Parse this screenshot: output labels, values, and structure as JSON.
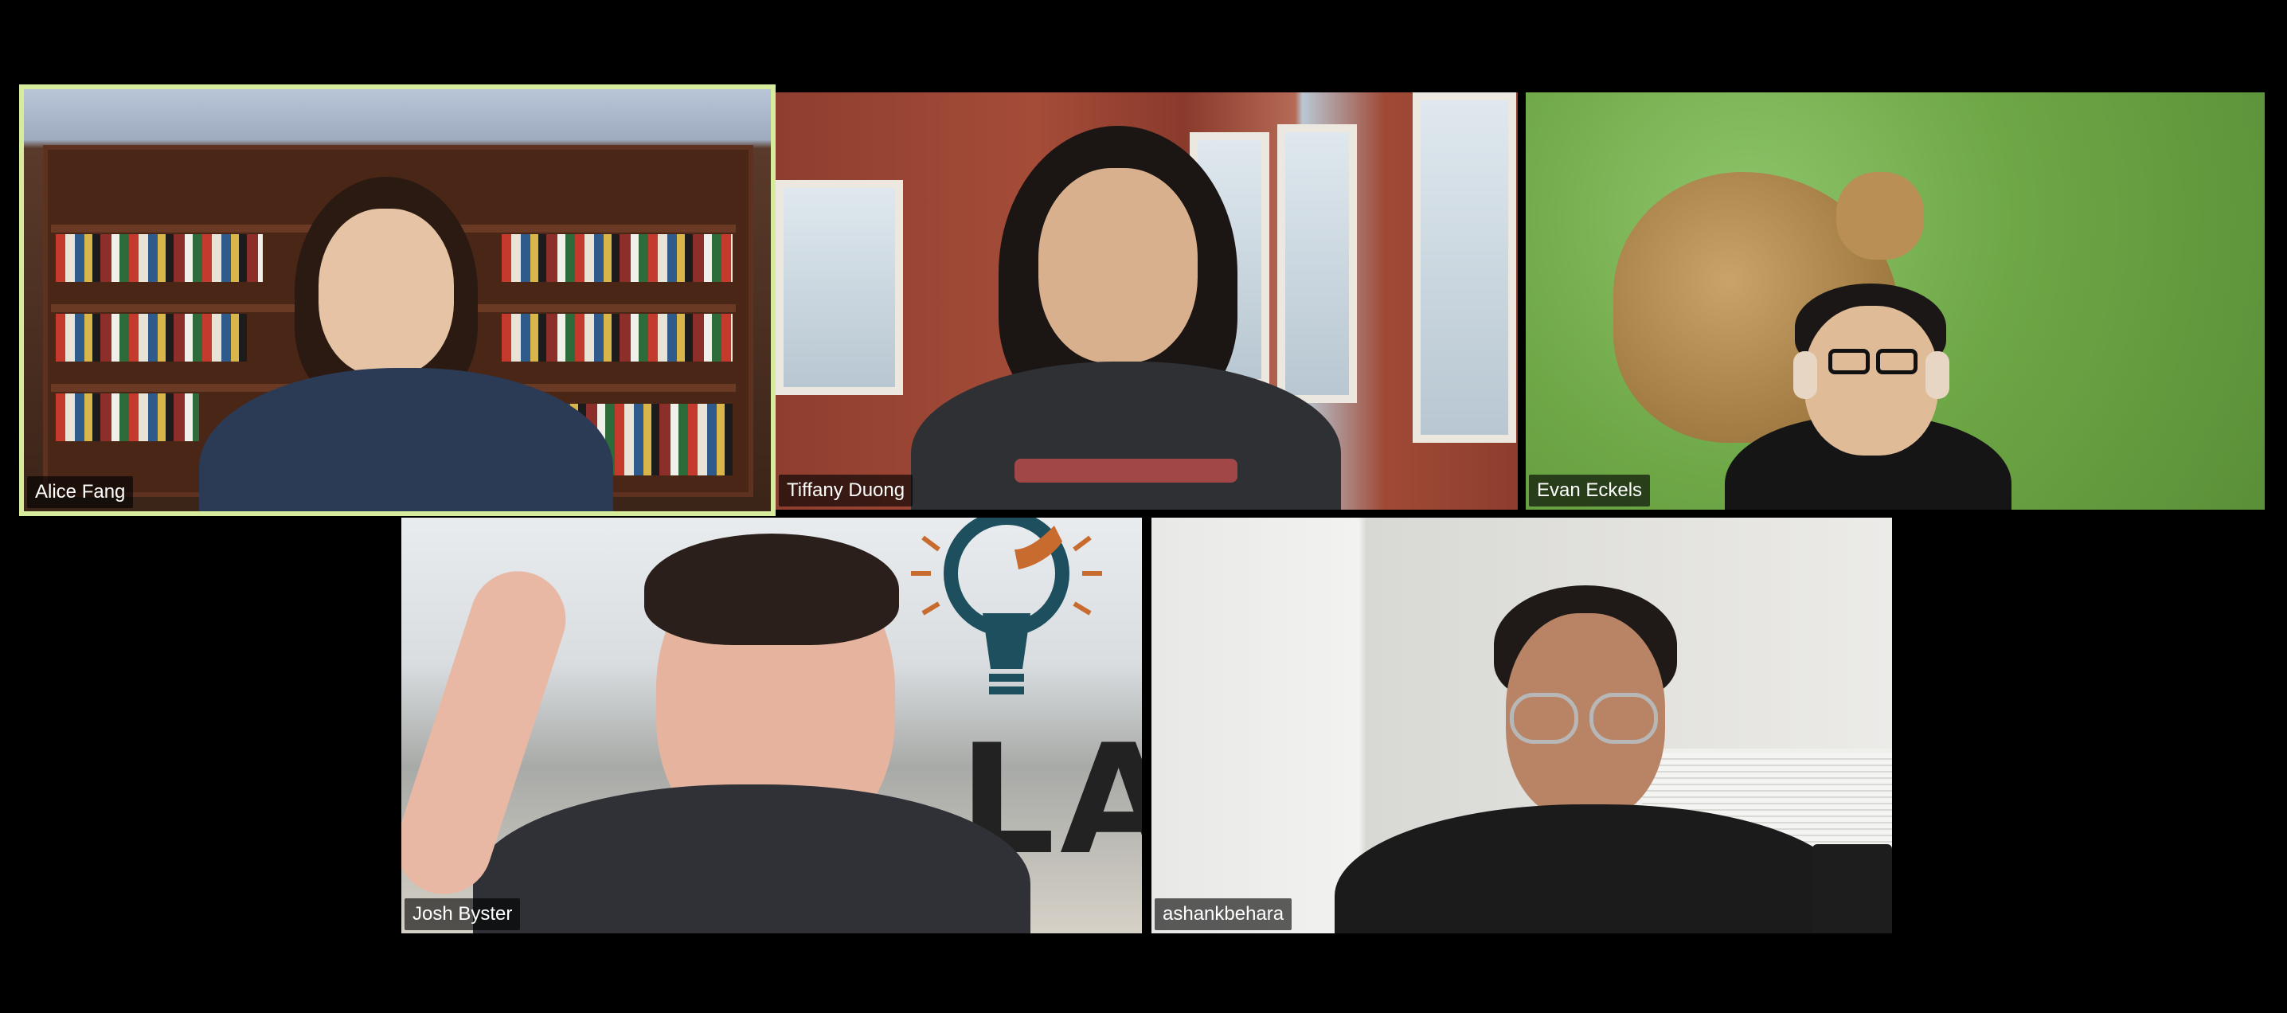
{
  "meeting": {
    "participants": [
      {
        "name": "Alice Fang",
        "active_speaker": true
      },
      {
        "name": "Tiffany Duong",
        "active_speaker": false
      },
      {
        "name": "Evan Eckels",
        "active_speaker": false
      },
      {
        "name": "Josh Byster",
        "active_speaker": false
      },
      {
        "name": "ashankbehara",
        "active_speaker": false
      }
    ],
    "background_text": {
      "lab_sign": "LAB"
    }
  },
  "colors": {
    "active_speaker_border": "#d6ec9c",
    "background": "#000000",
    "name_tag_bg": "rgba(0,0,0,0.62)"
  }
}
